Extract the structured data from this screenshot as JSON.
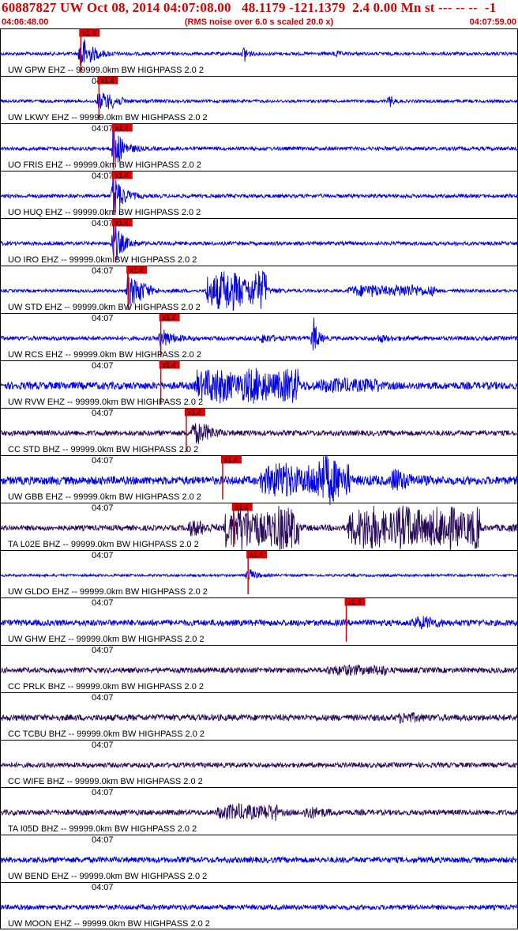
{
  "header": {
    "title": "60887827 UW Oct 08, 2014 04:07:08.00   48.1179 -121.1379  2.4 0.00 Mn st --- -- --  -1",
    "time_start": "04:06:48.00",
    "time_end": "04:07:59.00",
    "noise_note": "(RMS noise over 6.0 s scaled 20.0 x)"
  },
  "colors": {
    "header_red": "#d40000",
    "trace_blue": "#0000e6",
    "trace_purple": "#2a0a5c",
    "pick_red": "#e00000",
    "border": "#000000"
  },
  "chart_data": {
    "type": "seismogram",
    "time_axis": {
      "start": "04:06:48.00",
      "end": "04:07:59.00",
      "tick_label": "04:07"
    },
    "pick_label": "x1.4",
    "traces": [
      {
        "label": "UW GPW EHZ -- 99999.0km BW  HIGHPASS  2.0  2",
        "color": "blue",
        "pick_s": 11.0,
        "events": [
          [
            11.0,
            1.0,
            3
          ],
          [
            33.5,
            0.45,
            1
          ],
          [
            46.0,
            0.15,
            1
          ]
        ],
        "noise": 0.08
      },
      {
        "label": "UW LKWY EHZ -- 99999.0km BW  HIGHPASS  2.0  2",
        "color": "blue",
        "pick_s": 13.5,
        "events": [
          [
            13.5,
            0.55,
            6
          ],
          [
            53.5,
            0.3,
            1
          ]
        ],
        "noise": 0.07
      },
      {
        "label": "UO FRIS EHZ -- 99999.0km BW  HIGHPASS  2.0  2",
        "color": "blue",
        "pick_s": 15.5,
        "events": [
          [
            15.5,
            1.2,
            2.5
          ]
        ],
        "noise": 0.09
      },
      {
        "label": "UO HUQ EHZ -- 99999.0km BW  HIGHPASS  2.0  2",
        "color": "blue",
        "pick_s": 15.5,
        "events": [
          [
            15.5,
            1.2,
            2.5
          ]
        ],
        "noise": 0.09
      },
      {
        "label": "UO IRO EHZ -- 99999.0km BW  HIGHPASS  2.0  2",
        "color": "blue",
        "pick_s": 15.5,
        "events": [
          [
            15.5,
            1.1,
            2.5
          ]
        ],
        "noise": 0.09
      },
      {
        "label": "UW STD EHZ -- 99999.0km BW  HIGHPASS  2.0  2",
        "color": "blue",
        "pick_s": 17.5,
        "events": [
          [
            17.5,
            1.0,
            5
          ],
          [
            28.5,
            0.95,
            8
          ],
          [
            48.0,
            0.25,
            12
          ]
        ],
        "noise": 0.07
      },
      {
        "label": "UW RCS EHZ -- 99999.0km BW  HIGHPASS  2.0  2",
        "color": "blue",
        "pick_s": 22.0,
        "events": [
          [
            22.0,
            0.5,
            3
          ],
          [
            36.0,
            0.2,
            3
          ],
          [
            43.0,
            1.0,
            1.2
          ],
          [
            52.0,
            0.15,
            3
          ]
        ],
        "noise": 0.1
      },
      {
        "label": "UW RVW EHZ -- 99999.0km BW  HIGHPASS  2.0  2",
        "color": "blue",
        "pick_s": 22.0,
        "events": [
          [
            27.0,
            0.7,
            14
          ],
          [
            44.0,
            0.2,
            8
          ]
        ],
        "noise": 0.18
      },
      {
        "label": "CC STD BHZ -- 99999.0km BW  HIGHPASS  2.0  2",
        "color": "purple",
        "pick_s": 25.5,
        "events": [
          [
            26.5,
            0.65,
            5
          ]
        ],
        "noise": 0.13
      },
      {
        "label": "UW GBB EHZ -- 99999.0km BW  HIGHPASS  2.0  2",
        "color": "blue",
        "pick_s": 30.5,
        "events": [
          [
            36.0,
            0.7,
            12
          ],
          [
            44.0,
            0.85,
            5
          ],
          [
            54.0,
            0.55,
            4
          ]
        ],
        "noise": 0.2
      },
      {
        "label": "TA L02E BHZ -- 99999.0km BW  HIGHPASS  2.0  2",
        "color": "purple",
        "pick_s": 32.0,
        "events": [
          [
            31.0,
            1.0,
            10
          ],
          [
            48.0,
            1.0,
            18
          ],
          [
            26.0,
            0.45,
            5
          ]
        ],
        "noise": 0.13
      },
      {
        "label": "UW GLDO EHZ -- 99999.0km BW  HIGHPASS  2.0  2",
        "color": "blue",
        "pick_s": 34.0,
        "events": [
          [
            34.0,
            0.35,
            2
          ]
        ],
        "noise": 0.06
      },
      {
        "label": "UW GHW EHZ -- 99999.0km BW  HIGHPASS  2.0  2",
        "color": "blue",
        "pick_s": 47.5,
        "events": [
          [
            57.0,
            0.3,
            6
          ]
        ],
        "noise": 0.15
      },
      {
        "label": "CC PRLK BHZ -- 99999.0km BW  HIGHPASS  2.0  2",
        "color": "purple",
        "pick_s": null,
        "events": [
          [
            45.0,
            0.15,
            8
          ]
        ],
        "noise": 0.13
      },
      {
        "label": "CC TCBU BHZ -- 99999.0km BW  HIGHPASS  2.0  2",
        "color": "purple",
        "pick_s": null,
        "events": [
          [
            55.0,
            0.2,
            6
          ]
        ],
        "noise": 0.15
      },
      {
        "label": "CC WIFE BHZ -- 99999.0km BW  HIGHPASS  2.0  2",
        "color": "purple",
        "pick_s": null,
        "events": [],
        "noise": 0.12
      },
      {
        "label": "TA I05D BHZ -- 99999.0km BW  HIGHPASS  2.0  2",
        "color": "purple",
        "pick_s": null,
        "events": [
          [
            30.0,
            0.3,
            8
          ],
          [
            42.0,
            0.3,
            5
          ]
        ],
        "noise": 0.13
      },
      {
        "label": "UW BEND EHZ -- 99999.0km BW  HIGHPASS  2.0  2",
        "color": "blue",
        "pick_s": null,
        "events": [],
        "noise": 0.14
      },
      {
        "label": "UW MOON EHZ -- 99999.0km BW  HIGHPASS  2.0  2",
        "color": "blue",
        "pick_s": null,
        "events": [],
        "noise": 0.12
      }
    ]
  }
}
